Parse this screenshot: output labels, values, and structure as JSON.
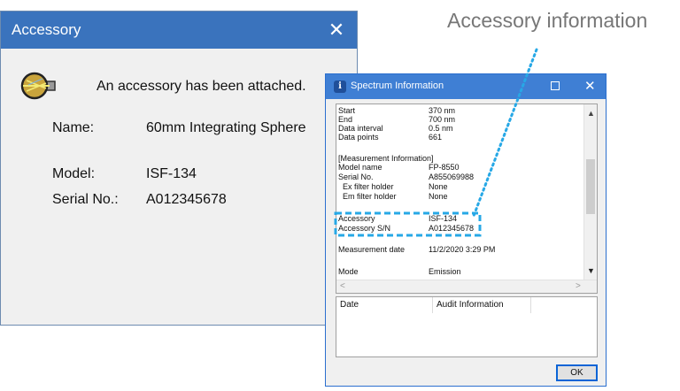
{
  "accessory_dialog": {
    "title": "Accessory",
    "close_glyph": "✕",
    "message": "An accessory has been attached.",
    "fields": [
      {
        "label": "Name:",
        "value": "60mm Integrating Sphere"
      },
      {
        "label": "Model:",
        "value": "ISF-134"
      },
      {
        "label": "Serial No.:",
        "value": "A012345678"
      }
    ],
    "icon": "integrating-sphere-icon",
    "titlebar_color": "#3a73bd"
  },
  "callout": {
    "label": "Accessory information",
    "color": "#27a8e6"
  },
  "spectrum_window": {
    "title": "Spectrum Information",
    "title_icon_glyph": "i",
    "close_glyph": "✕",
    "titlebar_color": "#3f7fd4",
    "rows": [
      {
        "key": "Start",
        "value": "370 nm"
      },
      {
        "key": "End",
        "value": "700 nm"
      },
      {
        "key": "Data interval",
        "value": "0.5 nm"
      },
      {
        "key": "Data points",
        "value": "661"
      },
      {
        "key": "[Measurement Information]",
        "value": ""
      },
      {
        "key": "Model name",
        "value": "FP-8550"
      },
      {
        "key": "Serial No.",
        "value": "A855069988"
      },
      {
        "key": "  Ex filter holder",
        "value": "None"
      },
      {
        "key": "  Em filter holder",
        "value": "None"
      },
      {
        "key": "Accessory",
        "value": "ISF-134"
      },
      {
        "key": "Accessory S/N",
        "value": "A012345678"
      },
      {
        "key": "Measurement date",
        "value": "11/2/2020 3:29 PM"
      },
      {
        "key": "Mode",
        "value": "Emission"
      }
    ],
    "scroll": {
      "up": "▲",
      "down": "▼",
      "left": "<",
      "right": ">"
    },
    "audit_columns": [
      "Date",
      "Audit Information"
    ],
    "ok_label": "OK"
  }
}
